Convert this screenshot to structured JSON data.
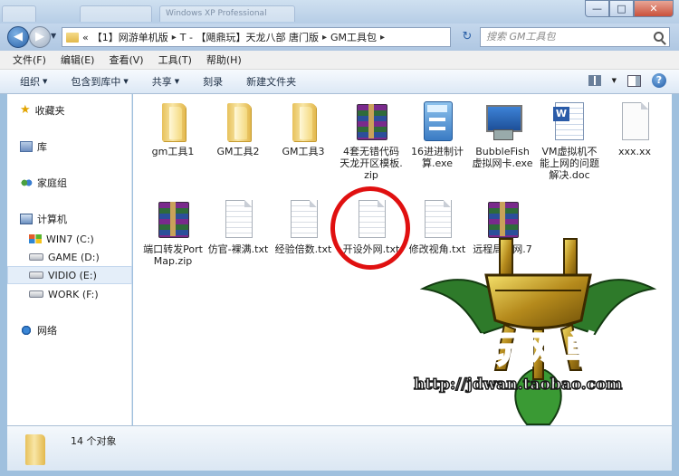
{
  "window": {
    "title": "Windows XP Professional",
    "ghost_tabs": [
      "",
      "",
      "Windows XP Professional"
    ],
    "controls": {
      "minimize": "—",
      "maximize": "□",
      "close": "✕"
    }
  },
  "address": {
    "overflow": "«",
    "crumbs": [
      "【1】网游单机版",
      "T - 【飓鼎玩】天龙八部 唐门版",
      "GM工具包"
    ],
    "search_placeholder": "搜索 GM工具包"
  },
  "menu": [
    "文件(F)",
    "编辑(E)",
    "查看(V)",
    "工具(T)",
    "帮助(H)"
  ],
  "commands": {
    "organize": "组织",
    "include_library": "包含到库中",
    "share": "共享",
    "burn": "刻录",
    "new_folder": "新建文件夹"
  },
  "nav": {
    "favorites": "收藏夹",
    "libraries": "库",
    "homegroup": "家庭组",
    "computer": "计算机",
    "drives": [
      "WIN7 (C:)",
      "GAME (D:)",
      "VIDIO (E:)",
      "WORK (F:)"
    ],
    "network": "网络"
  },
  "files": [
    {
      "name": "gm工具1",
      "icon": "folder-icon"
    },
    {
      "name": "GM工具2",
      "icon": "folder-icon"
    },
    {
      "name": "GM工具3",
      "icon": "folder-icon"
    },
    {
      "name": "4套无错代码天龙开区模板.zip",
      "icon": "archive-icon"
    },
    {
      "name": "16进进制计算.exe",
      "icon": "calculator-icon"
    },
    {
      "name": "BubbleFish虚拟网卡.exe",
      "icon": "exe-icon"
    },
    {
      "name": "VM虚拟机不能上网的问题解决.doc",
      "icon": "word-doc-icon"
    },
    {
      "name": "xxx.xx",
      "icon": "blank-file-icon"
    },
    {
      "name": "端口转发PortMap.zip",
      "icon": "archive-icon"
    },
    {
      "name": "仿官-裸满.txt",
      "icon": "text-file-icon"
    },
    {
      "name": "经验倍数.txt",
      "icon": "text-file-icon"
    },
    {
      "name": "开设外网.txt",
      "icon": "text-file-icon"
    },
    {
      "name": "修改视角.txt",
      "icon": "text-file-icon"
    },
    {
      "name": "远程局域网.7z",
      "icon": "archive-icon"
    }
  ],
  "watermark": {
    "brand": "飓鼎玩网单",
    "url": "http://jdwan.taobao.com"
  },
  "details": {
    "count": "14 个对象"
  },
  "colors": {
    "highlight": "#e01010",
    "selection": "#e4eef9"
  }
}
